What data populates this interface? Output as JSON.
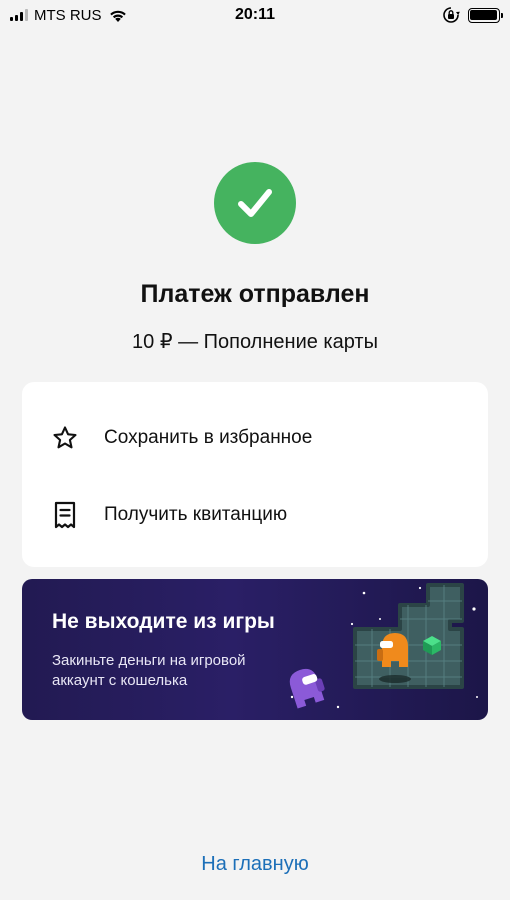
{
  "status_bar": {
    "carrier": "MTS RUS",
    "time": "20:11",
    "icons": [
      "signal-bars",
      "wifi-icon",
      "orientation-lock-icon",
      "battery-icon"
    ]
  },
  "payment": {
    "status_icon": "checkmark-icon",
    "status_color": "#45b35f",
    "title": "Платеж отправлен",
    "summary": "10 ₽ — Пополнение карты"
  },
  "actions": [
    {
      "icon": "star-icon",
      "label": "Сохранить в избранное"
    },
    {
      "icon": "receipt-icon",
      "label": "Получить квитанцию"
    }
  ],
  "banner": {
    "title": "Не выходите из игры",
    "text": "Закиньте деньги на игровой аккаунт с кошелька",
    "background": "#2a1f66"
  },
  "footer": {
    "home_link": "На главную",
    "link_color": "#1c6fb8"
  }
}
